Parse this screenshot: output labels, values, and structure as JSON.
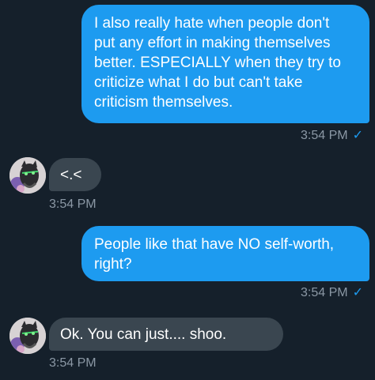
{
  "conversation": {
    "messages": [
      {
        "direction": "sent",
        "text": "I also really hate when people don't\nput any effort in making themselves\nbetter. ESPECIALLY when they try to\ncriticize what I do but can't take\ncriticism themselves.",
        "time": "3:54 PM",
        "status_icon": "checkmark-icon",
        "status_glyph": "✓"
      },
      {
        "direction": "received",
        "text": "<.<",
        "time": "3:54 PM",
        "avatar_icon": "avatar-icon"
      },
      {
        "direction": "sent",
        "text": "People like that have NO self-worth,\nright?",
        "time": "3:54 PM",
        "status_icon": "checkmark-icon",
        "status_glyph": "✓"
      },
      {
        "direction": "received",
        "text": "Ok. You can just.... shoo.",
        "time": "3:54 PM",
        "avatar_icon": "avatar-icon"
      }
    ]
  },
  "colors": {
    "background": "#15202b",
    "sent_bubble": "#1d9bf0",
    "received_bubble": "#3a4650",
    "timestamp": "#8b98a5",
    "check": "#1d9bf0"
  }
}
